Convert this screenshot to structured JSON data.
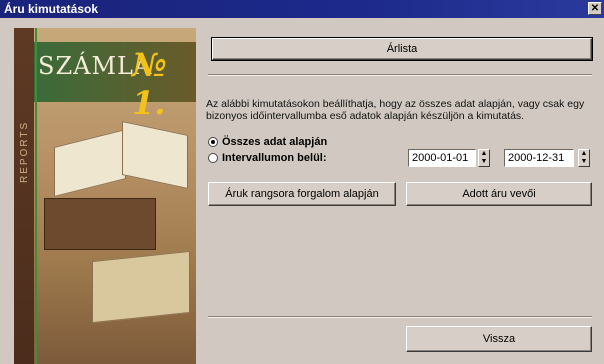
{
  "window": {
    "title": "Áru kimutatások",
    "close_label": "✕"
  },
  "art": {
    "brand": "SZÁMLA",
    "number": "№ 1.",
    "side_text": "REPORTS"
  },
  "buttons": {
    "list": "Árlista",
    "ranking": "Áruk rangsora forgalom alapján",
    "buyers": "Adott áru vevői",
    "back": "Vissza"
  },
  "description": "Az alábbi kimutatásokon beállíthatja, hogy az összes adat alapján, vagy csak egy bizonyos időintervallumba eső adatok alapján készüljön a kimutatás.",
  "options": {
    "all": "Összes adat alapján",
    "interval": "Intervallumon belül:",
    "selected": "all"
  },
  "dates": {
    "from": "2000-01-01",
    "to": "2000-12-31"
  },
  "icons": {
    "spin": "spin-arrows-icon",
    "radio": "radio-icon",
    "close": "close-icon"
  }
}
